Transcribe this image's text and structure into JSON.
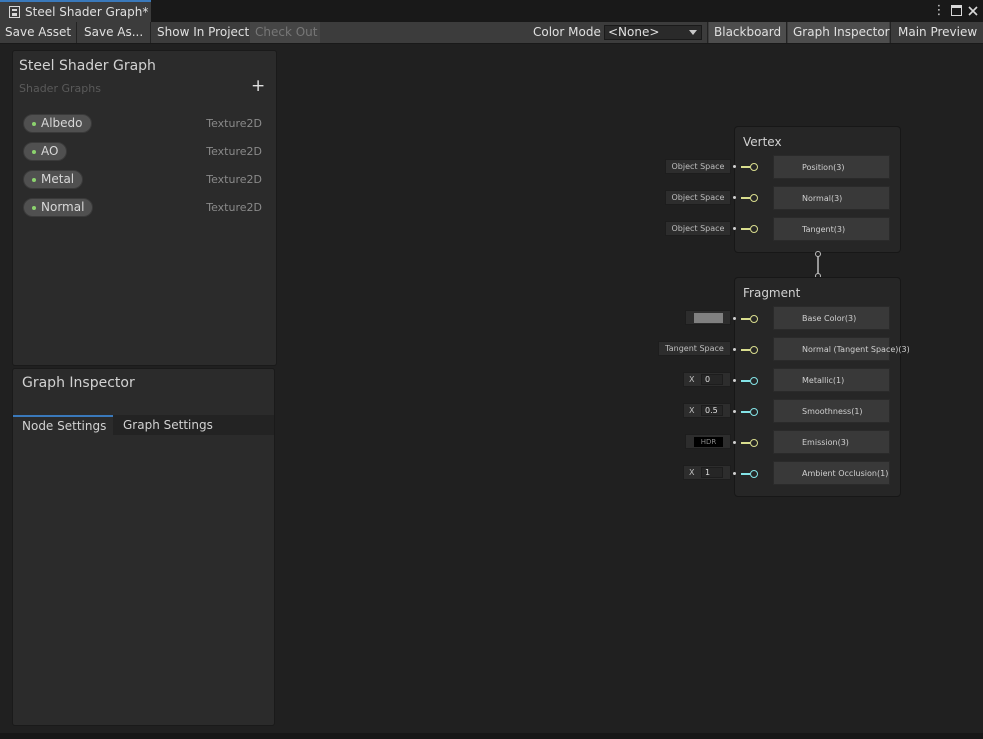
{
  "window": {
    "tab_title": "Steel Shader Graph*"
  },
  "toolbar": {
    "save_asset": "Save Asset",
    "save_as": "Save As...",
    "show_in_project": "Show In Project",
    "check_out": "Check Out",
    "color_mode_label": "Color Mode",
    "color_mode_value": "<None>",
    "blackboard": "Blackboard",
    "graph_inspector": "Graph Inspector",
    "main_preview": "Main Preview"
  },
  "blackboard": {
    "title": "Steel Shader Graph",
    "subtitle": "Shader Graphs",
    "add": "+",
    "properties": [
      {
        "name": "Albedo",
        "type": "Texture2D"
      },
      {
        "name": "AO",
        "type": "Texture2D"
      },
      {
        "name": "Metal",
        "type": "Texture2D"
      },
      {
        "name": "Normal",
        "type": "Texture2D"
      }
    ]
  },
  "inspector": {
    "title": "Graph Inspector",
    "tabs": [
      "Node Settings",
      "Graph Settings"
    ],
    "active_tab": "Node Settings"
  },
  "vertex": {
    "title": "Vertex",
    "blocks": [
      {
        "label": "Position(3)",
        "input": "Object Space"
      },
      {
        "label": "Normal(3)",
        "input": "Object Space"
      },
      {
        "label": "Tangent(3)",
        "input": "Object Space"
      }
    ]
  },
  "fragment": {
    "title": "Fragment",
    "blocks": [
      {
        "label": "Base Color(3)",
        "input_kind": "color",
        "color": "#808080"
      },
      {
        "label": "Normal (Tangent Space)(3)",
        "input": "Tangent Space"
      },
      {
        "label": "Metallic(1)",
        "x_label": "X",
        "value": "0"
      },
      {
        "label": "Smoothness(1)",
        "x_label": "X",
        "value": "0.5"
      },
      {
        "label": "Emission(3)",
        "input_kind": "hdr",
        "hdr_label": "HDR"
      },
      {
        "label": "Ambient Occlusion(1)",
        "x_label": "X",
        "value": "1"
      }
    ]
  },
  "colors": {
    "accent": "#3a79bb",
    "vector3_port": "#d9dd8e",
    "float_port": "#84e4e7",
    "property_dot": "#8cd36e"
  },
  "icons": {
    "tab_icon": "shader-graph-icon",
    "menu": "kebab-menu-icon",
    "maximize": "maximize-icon",
    "close": "close-icon",
    "dropdown": "chevron-down-icon"
  }
}
